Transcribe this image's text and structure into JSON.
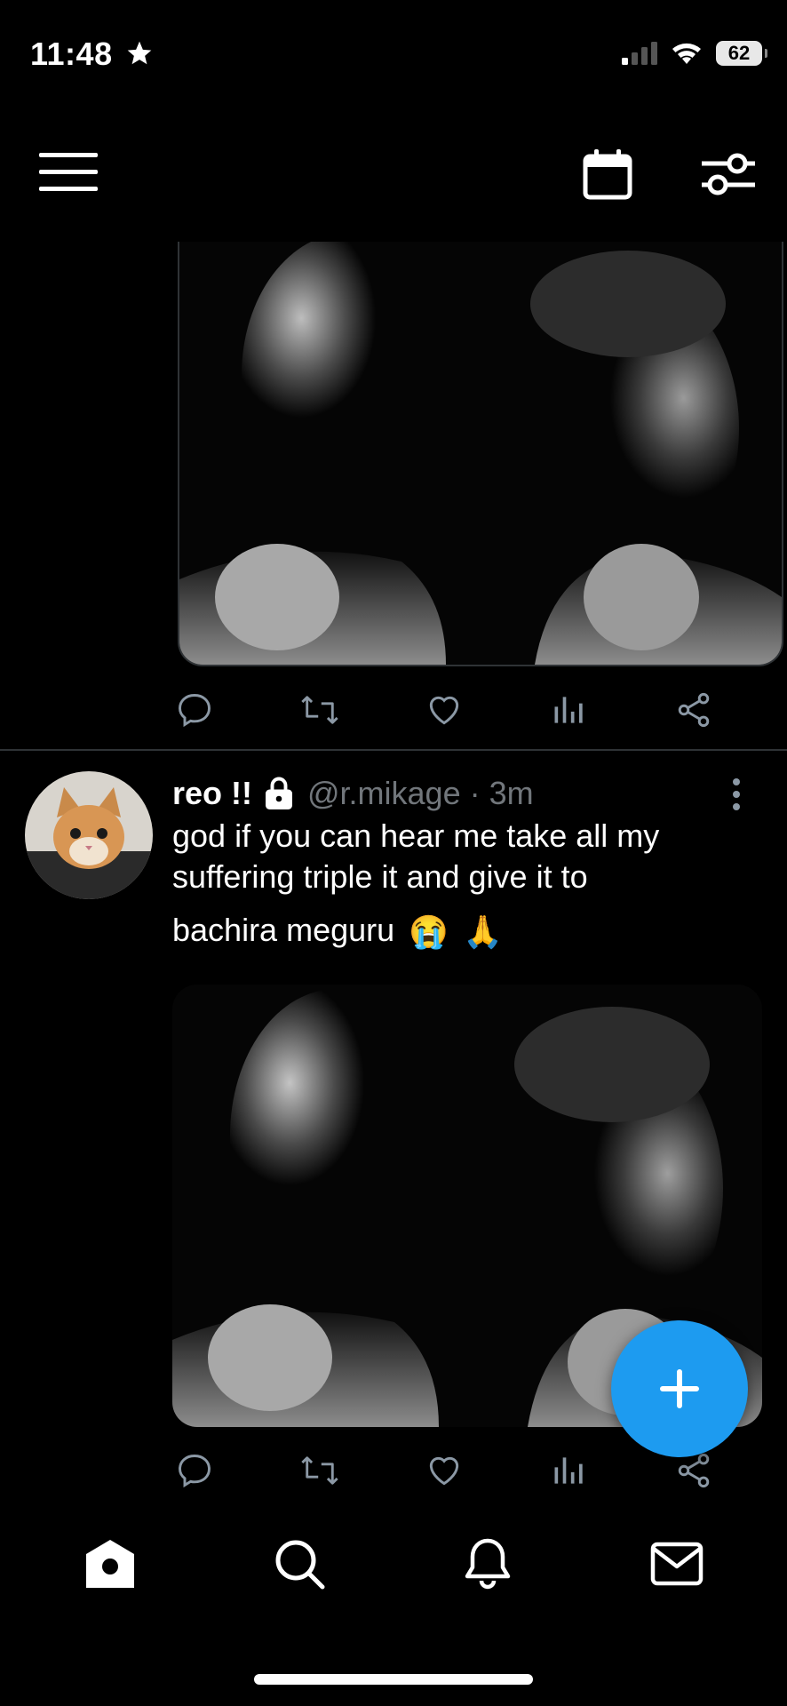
{
  "status_bar": {
    "time": "11:48",
    "battery": "62"
  },
  "tweet": {
    "display_name": "reo !!",
    "handle": "@r.mikage",
    "separator": "·",
    "time_ago": "3m",
    "text_line1": "god if you can hear me take all my",
    "text_line2": "suffering triple it and give it to",
    "text_line3": "bachira meguru",
    "emojis": [
      "😭",
      "🙏"
    ]
  },
  "icons": {
    "menu": "hamburger-menu-icon",
    "calendar": "calendar-icon",
    "filters": "sliders-icon",
    "reply": "speech-bubble-icon",
    "retweet": "retweet-icon",
    "like": "heart-icon",
    "views": "bar-chart-icon",
    "share": "share-icon",
    "compose": "plus-icon",
    "home": "home-icon",
    "search": "search-icon",
    "notifications": "bell-icon",
    "messages": "envelope-icon"
  },
  "colors": {
    "background": "#000000",
    "accent": "#1d9bf0",
    "muted_text": "#71767b",
    "icon_gray": "#8b98a5",
    "divider": "#2f3336"
  }
}
